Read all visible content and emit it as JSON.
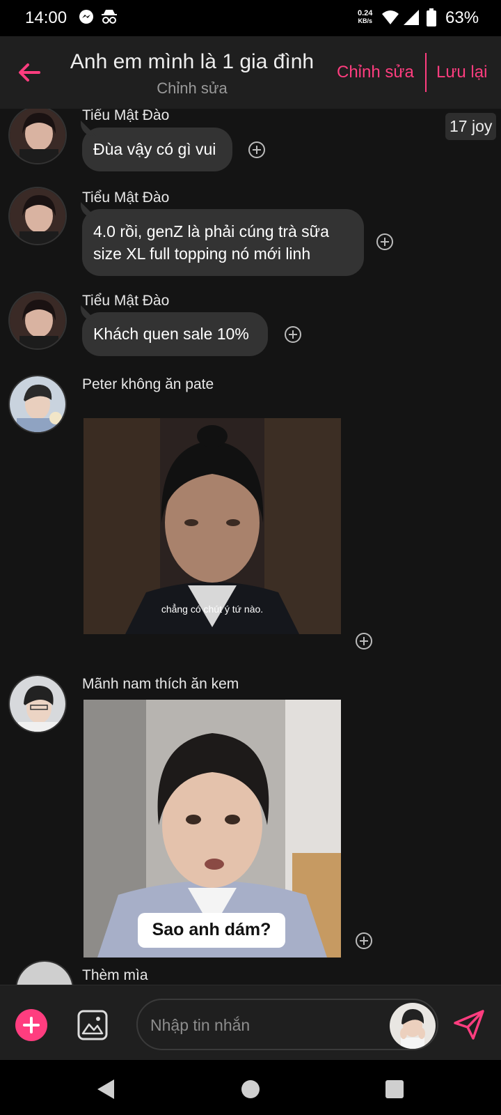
{
  "status_bar": {
    "time": "14:00",
    "net_speed_value": "0.24",
    "net_speed_unit": "KB/s",
    "battery": "63%",
    "icons": [
      "messenger-icon",
      "incognito-icon",
      "wifi-icon",
      "signal-icon",
      "battery-icon"
    ]
  },
  "header": {
    "title": "Anh em mình là 1 gia đình",
    "subtitle": "Chỉnh sửa",
    "edit_label": "Chỉnh sửa",
    "save_label": "Lưu lại",
    "accent_color": "#ff3d7f"
  },
  "messages": [
    {
      "sender": "Tiểu Mật Đào",
      "text": "Đùa vậy có gì vui",
      "badge": "17 joy"
    },
    {
      "sender": "Tiểu Mật Đào",
      "text_line1": "4.0 rồi, genZ là phải cúng trà sữa",
      "text_line2": "size XL full topping nó mới linh"
    },
    {
      "sender": "Tiểu Mật Đào",
      "text": "Khách quen sale 10%"
    },
    {
      "sender": "Peter không ăn pate",
      "image_caption": "chẳng có chút ý tứ nào."
    },
    {
      "sender": "Mãnh nam thích ăn kem",
      "image_caption": "Sao anh dám?"
    },
    {
      "sender": "Thèm mìa"
    }
  ],
  "composer": {
    "placeholder": "Nhập tin nhắn"
  }
}
